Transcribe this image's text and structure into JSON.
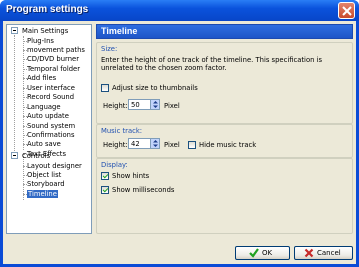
{
  "window": {
    "title": "Program settings"
  },
  "tree": {
    "main_settings": {
      "label": "Main Settings",
      "items": [
        "Plug-Ins",
        "movement paths",
        "CD/DVD burner",
        "Temporal folder",
        "Add files",
        "User interface",
        "Record Sound",
        "Language",
        "Auto update",
        "Sound system",
        "Confirmations",
        "Auto save",
        "Text Effects"
      ]
    },
    "controls": {
      "label": "Controls",
      "items": [
        "Layout designer",
        "Object list",
        "Storyboard",
        "Timeline"
      ]
    },
    "selected": "Timeline"
  },
  "panel": {
    "title": "Timeline",
    "size": {
      "label": "Size:",
      "description": "Enter the height of one track of the timeline. This specification is unrelated to the chosen zoom factor.",
      "adjust_label": "Adjust size to thumbnails",
      "adjust_checked": false,
      "height_label": "Height:",
      "height_value": "50",
      "unit": "Pixel"
    },
    "music": {
      "label": "Music track:",
      "height_label": "Height:",
      "height_value": "42",
      "unit": "Pixel",
      "hide_label": "Hide music track",
      "hide_checked": false
    },
    "display": {
      "label": "Display:",
      "show_hints_label": "Show hints",
      "show_hints_checked": true,
      "show_ms_label": "Show milliseconds",
      "show_ms_checked": true
    }
  },
  "buttons": {
    "ok": "OK",
    "cancel": "Cancel"
  },
  "colors": {
    "ok_check": "#21a121",
    "cancel_x": "#c62a2a",
    "selection": "#316ac5"
  }
}
